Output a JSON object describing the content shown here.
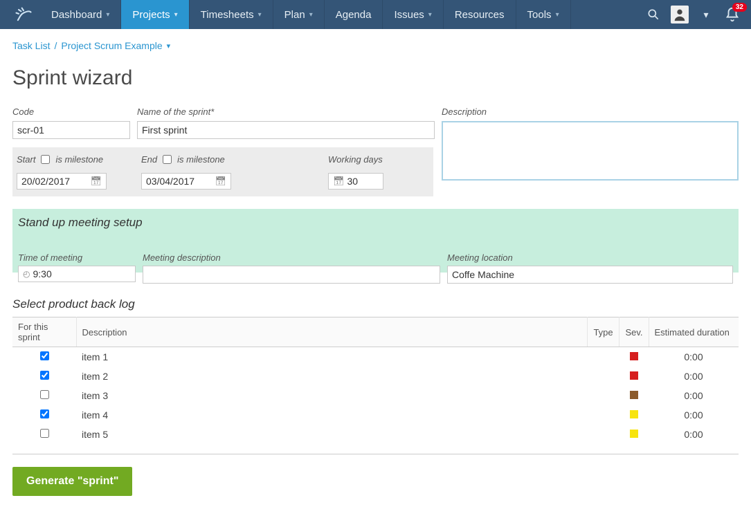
{
  "nav": {
    "items": [
      {
        "label": "Dashboard",
        "dropdown": true
      },
      {
        "label": "Projects",
        "dropdown": true,
        "active": true
      },
      {
        "label": "Timesheets",
        "dropdown": true
      },
      {
        "label": "Plan",
        "dropdown": true
      },
      {
        "label": "Agenda",
        "dropdown": false
      },
      {
        "label": "Issues",
        "dropdown": true
      },
      {
        "label": "Resources",
        "dropdown": false
      },
      {
        "label": "Tools",
        "dropdown": true
      }
    ],
    "notification_count": "32"
  },
  "breadcrumb": {
    "a": "Task List",
    "sep": "/",
    "b": "Project Scrum Example"
  },
  "page_title": "Sprint wizard",
  "form": {
    "code_label": "Code",
    "code_value": "scr-01",
    "name_label": "Name of the sprint*",
    "name_value": "First sprint",
    "description_label": "Description",
    "description_value": "",
    "start_label": "Start",
    "milestone_label": "is milestone",
    "start_value": "20/02/2017",
    "end_label": "End",
    "end_value": "03/04/2017",
    "working_days_label": "Working days",
    "working_days_value": "30"
  },
  "meeting": {
    "section_title": "Stand up meeting setup",
    "time_label": "Time of meeting",
    "time_value": "9:30",
    "desc_label": "Meeting description",
    "desc_value": "",
    "loc_label": "Meeting location",
    "loc_value": "Coffe Machine"
  },
  "backlog": {
    "title": "Select product back log",
    "headers": {
      "for_this_sprint": "For this sprint",
      "description": "Description",
      "type": "Type",
      "sev": "Sev.",
      "duration": "Estimated duration"
    },
    "rows": [
      {
        "checked": true,
        "desc": "item 1",
        "type": "",
        "sev_color": "#d61e1e",
        "duration": "0:00"
      },
      {
        "checked": true,
        "desc": "item 2",
        "type": "",
        "sev_color": "#d61e1e",
        "duration": "0:00"
      },
      {
        "checked": false,
        "desc": "item 3",
        "type": "",
        "sev_color": "#8b5a2b",
        "duration": "0:00"
      },
      {
        "checked": true,
        "desc": "item 4",
        "type": "",
        "sev_color": "#f7e40e",
        "duration": "0:00"
      },
      {
        "checked": false,
        "desc": "item 5",
        "type": "",
        "sev_color": "#f7e40e",
        "duration": "0:00"
      }
    ]
  },
  "buttons": {
    "generate": "Generate \"sprint\""
  }
}
